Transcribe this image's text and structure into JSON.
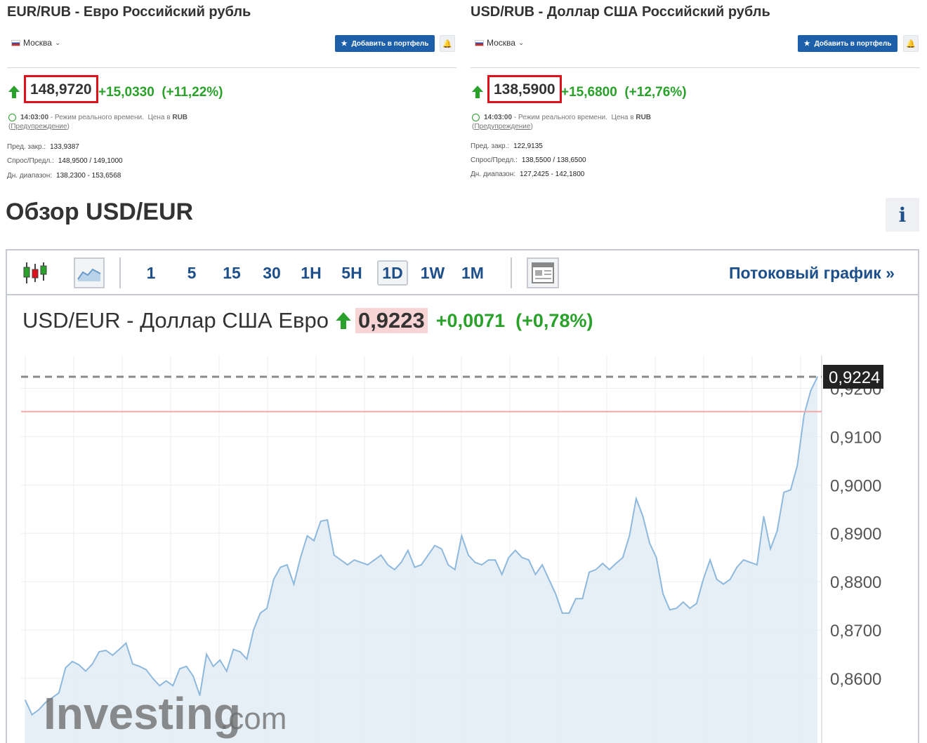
{
  "quotes": [
    {
      "title": "EUR/RUB - Евро Российский рубль",
      "location": "Москва",
      "add_label": "Добавить в портфель",
      "price": "148,9720",
      "change": "+15,0330",
      "change_pct": "(+11,22%)",
      "time": "14:03:00",
      "realtime": "- Режим реального времени.",
      "currency_label": "Цена в",
      "currency": "RUB",
      "warning_open": "(",
      "warning": "Предупреждение",
      "warning_close": ")",
      "prev_close_label": "Пред. закр.:",
      "prev_close": "133,9387",
      "bid_ask_label": "Спрос/Предл.:",
      "bid_ask": "148,9500  /  149,1000",
      "range_label": "Дн. диапазон:",
      "range": "138,2300 - 153,6568"
    },
    {
      "title": "USD/RUB - Доллар США Российский рубль",
      "location": "Москва",
      "add_label": "Добавить в портфель",
      "price": "138,5900",
      "change": "+15,6800",
      "change_pct": "(+12,76%)",
      "time": "14:03:00",
      "realtime": "- Режим реального времени.",
      "currency_label": "Цена в",
      "currency": "RUB",
      "warning_open": "(",
      "warning": "Предупреждение",
      "warning_close": ")",
      "prev_close_label": "Пред. закр.:",
      "prev_close": "122,9135",
      "bid_ask_label": "Спрос/Предл.:",
      "bid_ask": "138,5500  /  138,6500",
      "range_label": "Дн. диапазон:",
      "range": "127,2425 - 142,1800"
    }
  ],
  "overview": {
    "title": "Обзор USD/EUR",
    "info_label": "i"
  },
  "toolbar": {
    "periods": [
      "1",
      "5",
      "15",
      "30",
      "1H",
      "5H",
      "1D",
      "1W",
      "1M"
    ],
    "active_period": "1D",
    "stream_label": "Потоковый график »"
  },
  "chart_header": {
    "name": "USD/EUR - Доллар США Евро",
    "price": "0,9223",
    "change": "+0,0071",
    "change_pct": "(+0,78%)"
  },
  "watermark": {
    "brand": "Investing",
    "suffix": ".com"
  },
  "colors": {
    "brand_blue": "#1d5fa8",
    "positive": "#2aa12a",
    "highlight_red": "#e0101a",
    "line": "#8fb9dc",
    "area": "#e2ecf5"
  },
  "chart_data": {
    "type": "area",
    "title": "USD/EUR - Доллар США Евро",
    "y_ticks": [
      "0,8600",
      "0,8700",
      "0,8800",
      "0,8900",
      "0,9000",
      "0,9100",
      "0,9200"
    ],
    "y_tick_values": [
      0.86,
      0.87,
      0.88,
      0.89,
      0.9,
      0.91,
      0.92
    ],
    "ylim": [
      0.8535,
      0.9242
    ],
    "last_label": "0,9224",
    "last_value": 0.9224,
    "prev_close_value": 0.9152,
    "grid": true,
    "series": [
      {
        "values": [
          0.8555,
          0.8525,
          0.8535,
          0.855,
          0.856,
          0.857,
          0.8622,
          0.8635,
          0.8628,
          0.8615,
          0.863,
          0.8655,
          0.8658,
          0.8648,
          0.866,
          0.8673,
          0.863,
          0.8625,
          0.8618,
          0.86,
          0.8585,
          0.8595,
          0.8585,
          0.862,
          0.8625,
          0.8605,
          0.8565,
          0.865,
          0.8625,
          0.8638,
          0.8615,
          0.866,
          0.8655,
          0.864,
          0.87,
          0.8735,
          0.8745,
          0.8805,
          0.883,
          0.8835,
          0.8795,
          0.885,
          0.8895,
          0.8885,
          0.8925,
          0.8928,
          0.8855,
          0.8845,
          0.8835,
          0.8845,
          0.884,
          0.8835,
          0.8845,
          0.8855,
          0.8835,
          0.8825,
          0.884,
          0.8865,
          0.883,
          0.8835,
          0.8855,
          0.8875,
          0.8868,
          0.8835,
          0.8825,
          0.8895,
          0.8855,
          0.884,
          0.8835,
          0.8845,
          0.8845,
          0.8815,
          0.885,
          0.8865,
          0.885,
          0.8845,
          0.8815,
          0.8835,
          0.8805,
          0.8775,
          0.8735,
          0.8735,
          0.8765,
          0.8765,
          0.882,
          0.8825,
          0.8838,
          0.8825,
          0.8838,
          0.885,
          0.8895,
          0.8972,
          0.8935,
          0.888,
          0.885,
          0.8775,
          0.8742,
          0.8745,
          0.8758,
          0.8745,
          0.8755,
          0.8805,
          0.8845,
          0.8805,
          0.8795,
          0.8805,
          0.883,
          0.8845,
          0.884,
          0.8835,
          0.8935,
          0.8868,
          0.8905,
          0.8985,
          0.899,
          0.904,
          0.9145,
          0.9195,
          0.9224
        ]
      }
    ]
  }
}
